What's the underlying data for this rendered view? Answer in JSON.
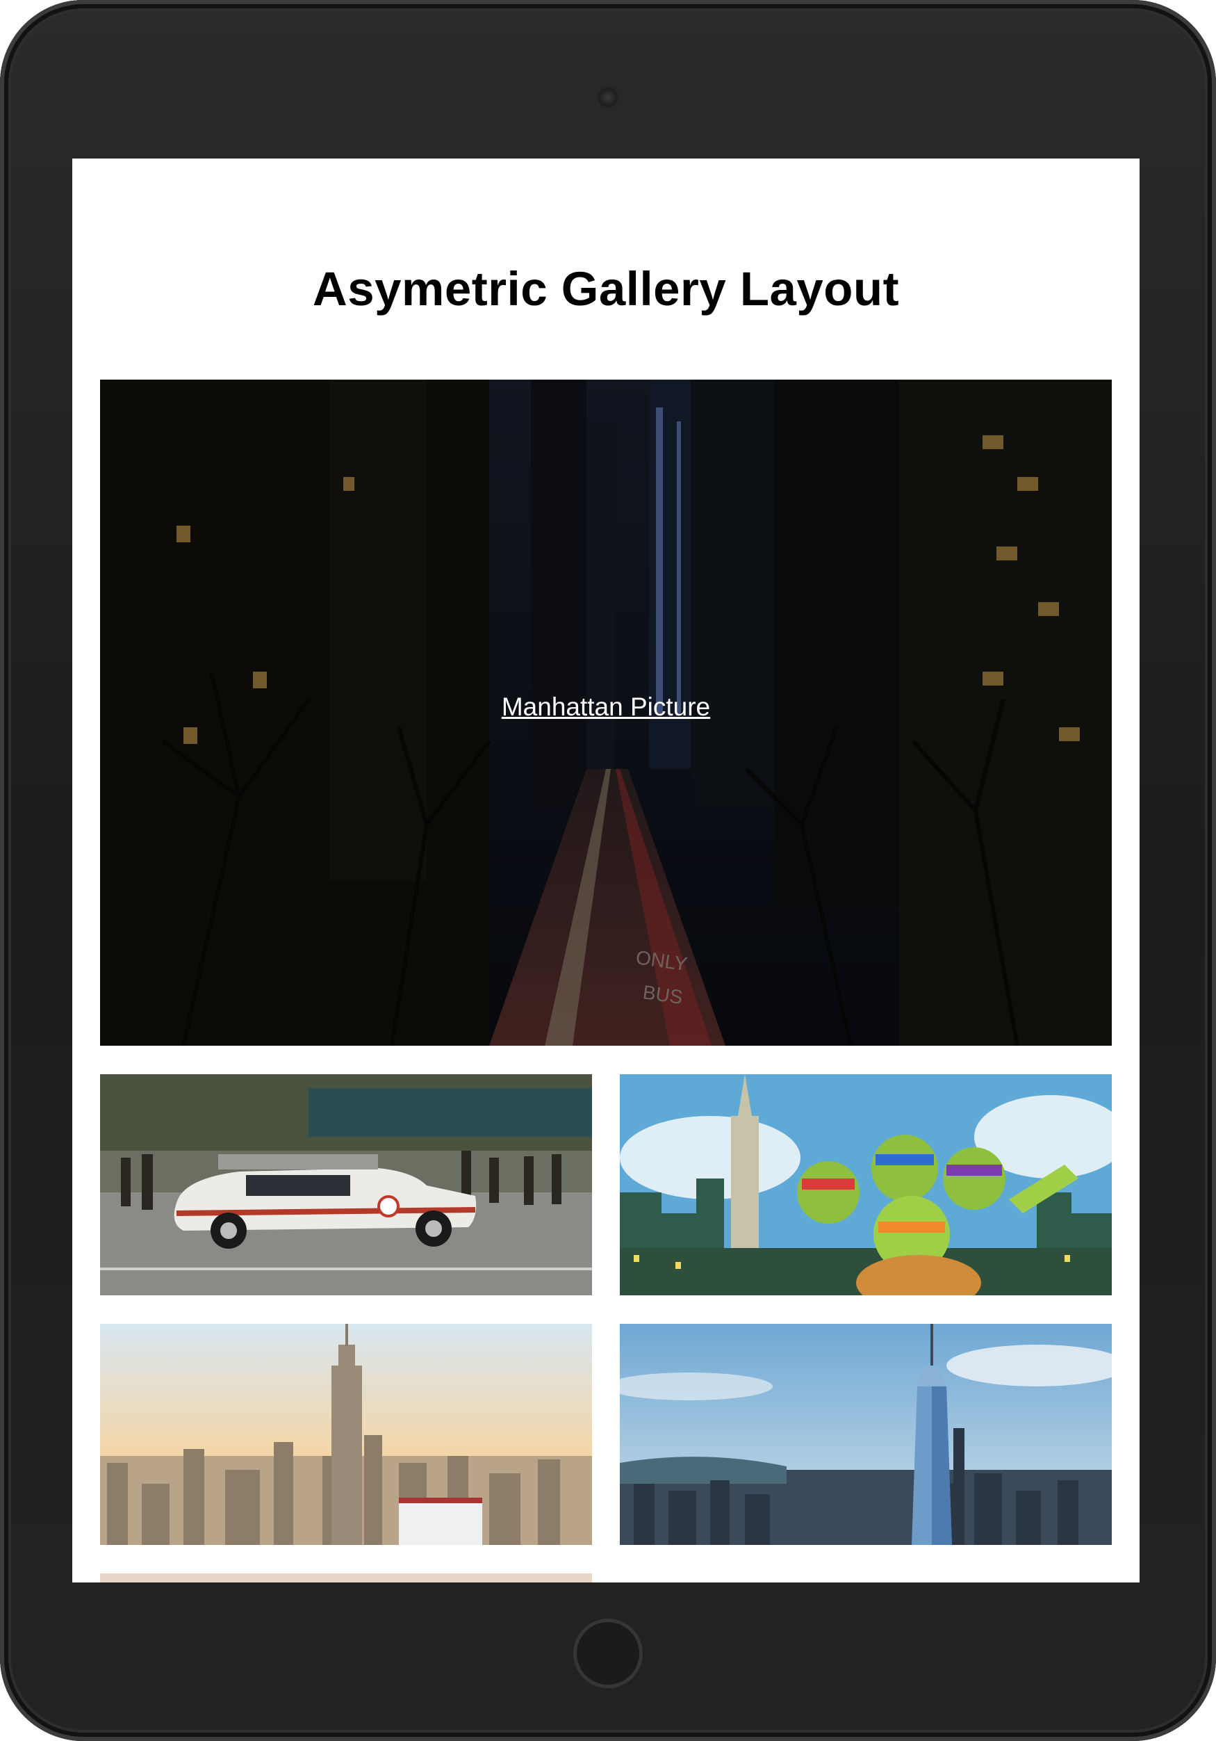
{
  "page": {
    "title": "Asymetric Gallery Layout"
  },
  "gallery": {
    "hero_caption": "Manhattan Picture",
    "tiles": [
      {
        "name": "manhattan-night-street",
        "icon": "city-street-image"
      },
      {
        "name": "ghostbusters-ecto-car",
        "icon": "car-image"
      },
      {
        "name": "ninja-turtles-skyline",
        "icon": "cartoon-image"
      },
      {
        "name": "empire-state-skyline",
        "icon": "skyline-image"
      },
      {
        "name": "one-world-trade-skyline",
        "icon": "skyline-image"
      },
      {
        "name": "partial-image",
        "icon": "image"
      }
    ]
  },
  "colors": {
    "screen_background": "#ffffff",
    "device_frame": "#1f1f1f",
    "title_text": "#000000",
    "caption_text": "#ffffff"
  }
}
